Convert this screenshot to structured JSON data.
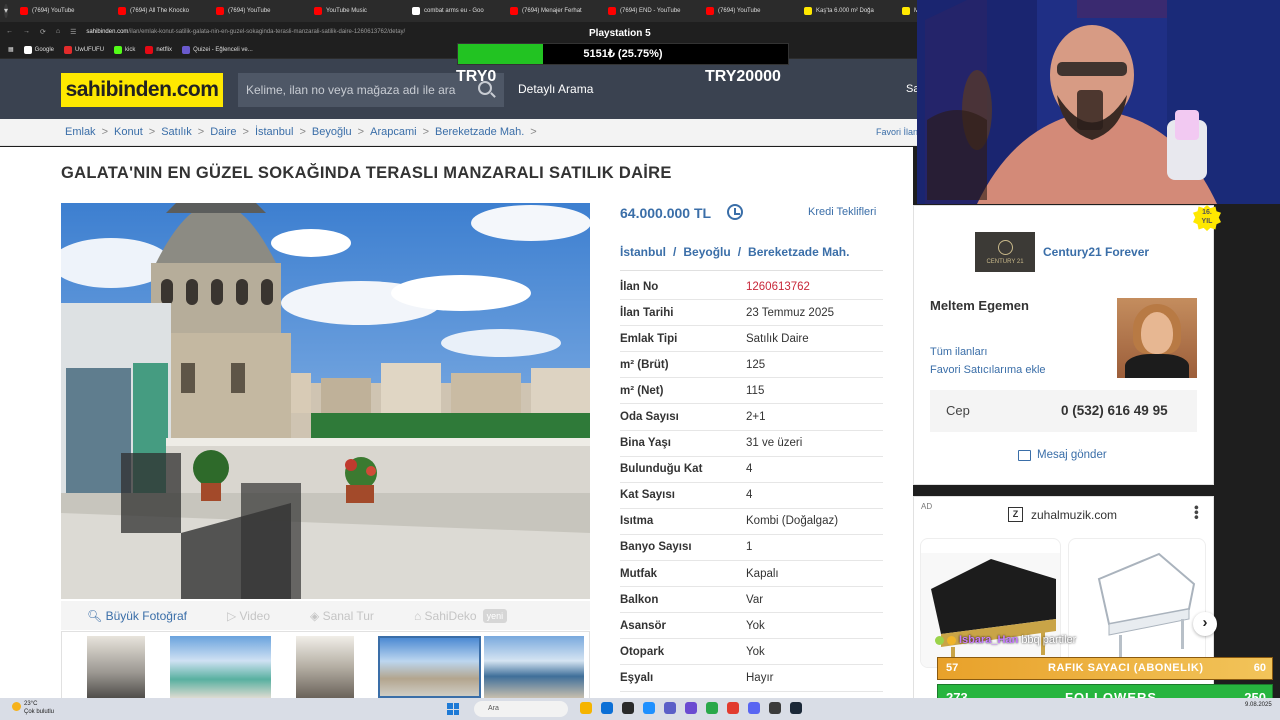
{
  "browser": {
    "tabs": [
      {
        "label": "(7694) YouTube",
        "color": "#ff0000"
      },
      {
        "label": "(7694) All The Knocko",
        "color": "#ff0000"
      },
      {
        "label": "(7694) YouTube",
        "color": "#ff0000"
      },
      {
        "label": "YouTube Music",
        "color": "#ff0000"
      },
      {
        "label": "combat arms eu - Goo",
        "color": "#ffffff"
      },
      {
        "label": "(7694) Menajer Ferhat",
        "color": "#ff0000"
      },
      {
        "label": "(7694) END - YouTube",
        "color": "#ff0000"
      },
      {
        "label": "(7694) YouTube",
        "color": "#ff0000"
      },
      {
        "label": "Kaş'ta 6.000 m² Doğa",
        "color": "#ffe800"
      },
      {
        "label": "Mavi",
        "color": "#ffe800"
      }
    ],
    "url_domain": "sahibinden.com",
    "url_path": "/ilan/emlak-konut-satilik-galata-nin-en-guzel-sokaginda-terasli-manzarali-satilik-daire-1260613762/detay/",
    "bookmarks": [
      {
        "label": "Google",
        "color": "#ffffff"
      },
      {
        "label": "UwUFUFU",
        "color": "#e22b2b"
      },
      {
        "label": "kick",
        "color": "#53fc18"
      },
      {
        "label": "netflix",
        "color": "#e50914"
      },
      {
        "label": "Quizei - Eğlenceli ve...",
        "color": "#6a5acd"
      }
    ]
  },
  "site": {
    "logo": "sahibinden.com",
    "search_placeholder": "Kelime, ilan no veya mağaza adı ile ara",
    "advanced_search": "Detaylı Arama",
    "header_right": "Sa",
    "breadcrumb": [
      "Emlak",
      "Konut",
      "Satılık",
      "Daire",
      "İstanbul",
      "Beyoğlu",
      "Arapcami",
      "Bereketzade Mah."
    ],
    "breadcrumb_sep": ">",
    "favorite_label": "Favori İlan",
    "title": "GALATA'NIN EN GÜZEL SOKAĞINDA TERASLI MANZARALI SATILIK DAİRE"
  },
  "photo_tools": {
    "big_photo": "Büyük Fotoğraf",
    "video": "Video",
    "virtual_tour": "Sanal Tur",
    "sahideko": "SahiDeko",
    "new_badge": "yeni"
  },
  "listing": {
    "price": "64.000.000 TL",
    "credit": "Kredi Teklifleri",
    "location": [
      "İstanbul",
      "Beyoğlu",
      "Bereketzade Mah."
    ],
    "location_sep": "/",
    "details": [
      {
        "k": "İlan No",
        "v": "1260613762",
        "highlight": true
      },
      {
        "k": "İlan Tarihi",
        "v": "23 Temmuz 2025"
      },
      {
        "k": "Emlak Tipi",
        "v": "Satılık Daire"
      },
      {
        "k": "m² (Brüt)",
        "v": "125"
      },
      {
        "k": "m² (Net)",
        "v": "115"
      },
      {
        "k": "Oda Sayısı",
        "v": "2+1"
      },
      {
        "k": "Bina Yaşı",
        "v": "31 ve üzeri"
      },
      {
        "k": "Bulunduğu Kat",
        "v": "4"
      },
      {
        "k": "Kat Sayısı",
        "v": "4"
      },
      {
        "k": "Isıtma",
        "v": "Kombi (Doğalgaz)"
      },
      {
        "k": "Banyo Sayısı",
        "v": "1"
      },
      {
        "k": "Mutfak",
        "v": "Kapalı"
      },
      {
        "k": "Balkon",
        "v": "Var"
      },
      {
        "k": "Asansör",
        "v": "Yok"
      },
      {
        "k": "Otopark",
        "v": "Yok"
      },
      {
        "k": "Eşyalı",
        "v": "Hayır"
      }
    ]
  },
  "seller": {
    "year_badge_num": "16.",
    "year_badge_word": "YIL",
    "logo_text": "CENTURY 21",
    "agency": "Century21 Forever",
    "agent": "Meltem Egemen",
    "all_listings": "Tüm ilanları",
    "add_favorite": "Favori Satıcılarıma ekle",
    "phone_label": "Cep",
    "phone": "0 (532) 616 49 95",
    "message": "Mesaj gönder"
  },
  "ad": {
    "label": "AD",
    "advertiser": "zuhalmuzik.com",
    "icon_letter": "Z"
  },
  "overlay": {
    "goal_title": "Playstation 5",
    "goal_text": "5151₺ (25.75%)",
    "goal_progress": 0.2575,
    "goal_min": "TRY0",
    "goal_max": "TRY20000",
    "chat_user": "Isbara_Han",
    "chat_msg": "bbq partiler",
    "sub_goal_current": "57",
    "sub_goal_label": "RAFIK SAYACI (ABONELIK)",
    "sub_goal_target": "60",
    "follow_current": "273",
    "follow_label": "FOLLOWERS",
    "follow_target": "250"
  },
  "taskbar": {
    "temperature": "23°C",
    "weather": "Çok bulutlu",
    "search": "Ara",
    "date": "9.08.2025"
  }
}
